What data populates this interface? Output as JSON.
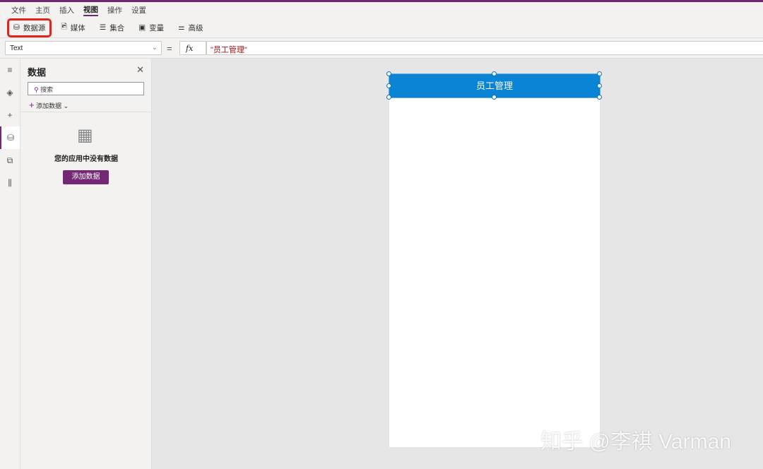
{
  "menu": [
    "文件",
    "主页",
    "插入",
    "视图",
    "操作",
    "设置"
  ],
  "toolbar": {
    "datasource": "数据源",
    "media": "媒体",
    "collections": "集合",
    "variables": "变量",
    "advanced": "高级"
  },
  "formula": {
    "property": "Text",
    "equals": "=",
    "fx": "fx",
    "value": "\"员工管理\""
  },
  "panel": {
    "title": "数据",
    "search_placeholder": "搜索",
    "add_data": "添加数据",
    "empty": "您的应用中没有数据",
    "add_button": "添加数据"
  },
  "canvas": {
    "header_text": "员工管理"
  },
  "watermark": "知乎 @李祺 Varman"
}
